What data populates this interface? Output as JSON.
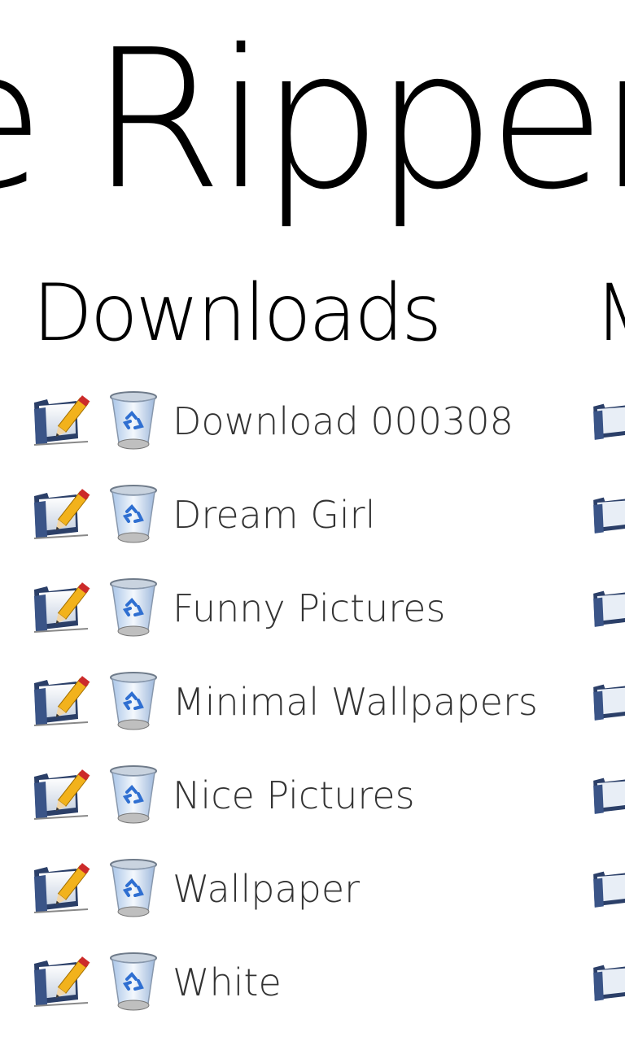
{
  "app": {
    "title": "e Ripper"
  },
  "sections": {
    "current_header": "Downloads",
    "next_header": "M"
  },
  "downloads": [
    {
      "label": "Download 000308",
      "edit_icon": "edit-folder-icon",
      "delete_icon": "recycle-bin-icon"
    },
    {
      "label": "Dream Girl",
      "edit_icon": "edit-folder-icon",
      "delete_icon": "recycle-bin-icon"
    },
    {
      "label": "Funny Pictures",
      "edit_icon": "edit-folder-icon",
      "delete_icon": "recycle-bin-icon"
    },
    {
      "label": "Minimal Wallpapers",
      "edit_icon": "edit-folder-icon",
      "delete_icon": "recycle-bin-icon"
    },
    {
      "label": "Nice Pictures",
      "edit_icon": "edit-folder-icon",
      "delete_icon": "recycle-bin-icon"
    },
    {
      "label": "Wallpaper",
      "edit_icon": "edit-folder-icon",
      "delete_icon": "recycle-bin-icon"
    },
    {
      "label": "White",
      "edit_icon": "edit-folder-icon",
      "delete_icon": "recycle-bin-icon"
    }
  ],
  "colors": {
    "background": "#ffffff",
    "folder_dark": "#2b3f68",
    "folder_light": "#e8eef6",
    "pencil": "#f2b21c",
    "pencil_tip": "#cc2a2a",
    "bin_blue": "#2f6fd1",
    "label": "#333333"
  }
}
